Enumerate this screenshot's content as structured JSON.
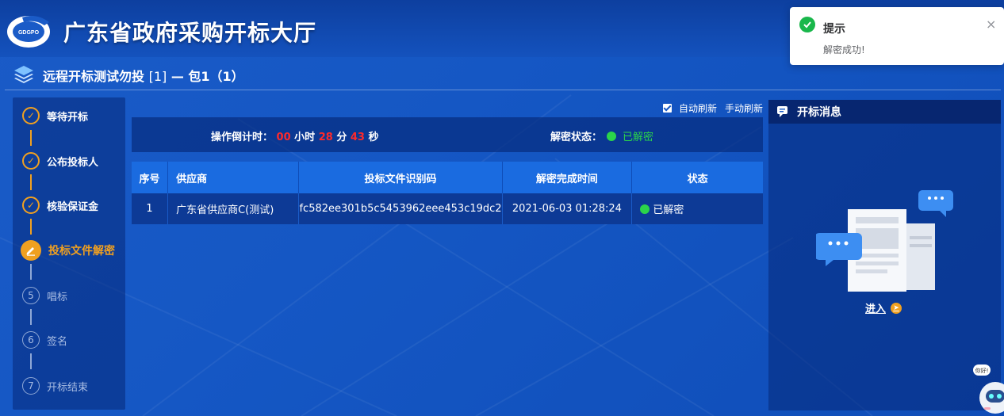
{
  "header": {
    "logo_text": "GDGPO",
    "title": "广东省政府采购开标大厅"
  },
  "project": {
    "title": "远程开标测试勿投",
    "index": "[1]",
    "package": "— 包1（1）"
  },
  "steps": [
    {
      "label": "等待开标",
      "state": "done",
      "icon": "check-icon"
    },
    {
      "label": "公布投标人",
      "state": "done",
      "icon": "check-icon"
    },
    {
      "label": "核验保证金",
      "state": "done",
      "icon": "check-icon"
    },
    {
      "label": "投标文件解密",
      "state": "active",
      "icon": "pencil-icon"
    },
    {
      "label": "唱标",
      "state": "todo",
      "number": "5"
    },
    {
      "label": "签名",
      "state": "todo",
      "number": "6"
    },
    {
      "label": "开标结束",
      "state": "todo",
      "number": "7"
    }
  ],
  "refresh": {
    "auto_label": "自动刷新",
    "auto_checked": true,
    "manual_label": "手动刷新"
  },
  "countdown": {
    "label": "操作倒计时：",
    "hours": "00",
    "hours_unit": "小时",
    "minutes": "28",
    "minutes_unit": "分",
    "seconds": "43",
    "seconds_unit": "秒",
    "decrypt_label": "解密状态：",
    "decrypt_status": "已解密",
    "status_color": "#2bd44a"
  },
  "table": {
    "headers": [
      "序号",
      "供应商",
      "投标文件识别码",
      "解密完成时间",
      "状态"
    ],
    "rows": [
      [
        "1",
        "广东省供应商C(测试)",
        "fc582ee301b5c5453962eee453c19dc2",
        "2021-06-03 01:28:24",
        "已解密"
      ]
    ]
  },
  "messages": {
    "title": "开标消息",
    "enter_label": "进入"
  },
  "toast": {
    "title": "提示",
    "message": "解密成功!",
    "close": "×"
  },
  "robot": {
    "bubble": "你好!"
  }
}
